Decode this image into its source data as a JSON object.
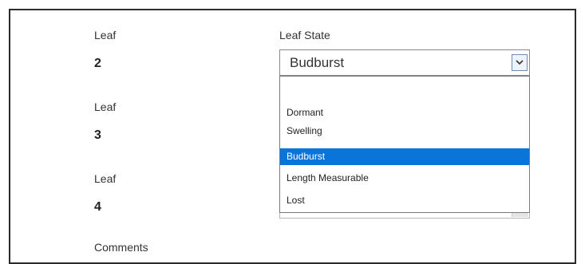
{
  "leaves": [
    {
      "label": "Leaf",
      "number": "2"
    },
    {
      "label": "Leaf",
      "number": "3"
    },
    {
      "label": "Leaf",
      "number": "4"
    }
  ],
  "leaf_state": {
    "label": "Leaf State",
    "selected": "Budburst",
    "options": [
      "",
      "Dormant",
      "Swelling",
      "Budburst",
      "Length Measurable",
      "Lost"
    ],
    "highlighted_index": 3
  },
  "comments_label": "Comments",
  "colors": {
    "highlight": "#0a74d8",
    "frame": "#2b2b2b"
  },
  "icons": {
    "dropdown_arrow": "chevron-down-icon"
  }
}
